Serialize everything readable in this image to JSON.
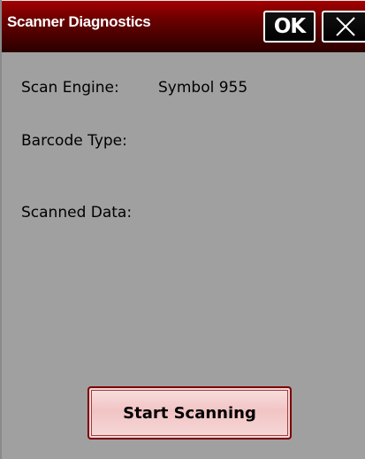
{
  "window": {
    "title": "Scanner Diagnostics",
    "ok_label": "OK",
    "close_icon": "close-icon"
  },
  "fields": {
    "scan_engine_label": "Scan Engine:",
    "scan_engine_value": "Symbol 955",
    "barcode_type_label": "Barcode Type:",
    "barcode_type_value": "",
    "scanned_data_label": "Scanned Data:",
    "scanned_data_value": ""
  },
  "actions": {
    "start_label": "Start Scanning"
  },
  "colors": {
    "titlebar": "#6c0000",
    "background": "#a0a0a0",
    "button_fill": "#f2c4c4",
    "button_border": "#7a0000"
  }
}
